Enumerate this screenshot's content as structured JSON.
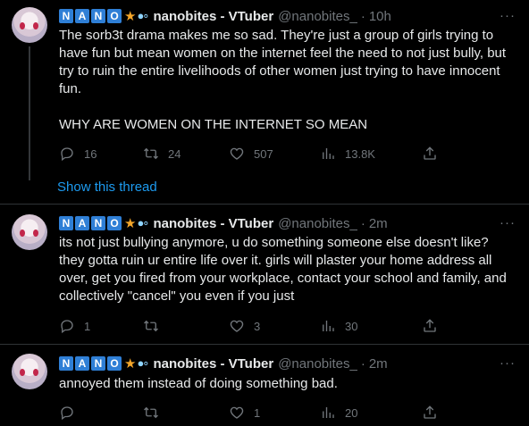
{
  "colors": {
    "background": "#000000",
    "text": "#e7e9ea",
    "muted": "#71767b",
    "link": "#1d9bf0",
    "badge": "#2f7fd6",
    "divider": "#2f3336"
  },
  "icons": [
    "avatar",
    "star-icon",
    "bubbles-icon",
    "more-icon",
    "reply-icon",
    "retweet-icon",
    "like-icon",
    "views-icon",
    "share-icon"
  ],
  "tweets": [
    {
      "badge_letters": [
        "N",
        "A",
        "N",
        "O"
      ],
      "display_name": "nanobites - VTuber",
      "handle": "@nanobites_",
      "dot": "·",
      "time": "10h",
      "more": "···",
      "text": "The sorb3t drama makes me so sad. They're just a group of girls trying to have fun but mean women on the internet feel the need to not just bully, but try to ruin the entire livelihoods of other women just trying to have innocent fun.\n\nWHY ARE WOMEN ON THE INTERNET SO MEAN",
      "stats": {
        "replies": "16",
        "retweets": "24",
        "likes": "507",
        "views": "13.8K"
      }
    },
    {
      "badge_letters": [
        "N",
        "A",
        "N",
        "O"
      ],
      "display_name": "nanobites - VTuber",
      "handle": "@nanobites_",
      "dot": "·",
      "time": "2m",
      "more": "···",
      "text": "its not just bullying anymore, u do something someone else doesn't like? they gotta ruin ur entire life over it. girls will plaster your home address all over, get you fired from your workplace, contact your school and family, and collectively \"cancel\" you even if you just",
      "stats": {
        "replies": "1",
        "retweets": "",
        "likes": "3",
        "views": "30"
      }
    },
    {
      "badge_letters": [
        "N",
        "A",
        "N",
        "O"
      ],
      "display_name": "nanobites - VTuber",
      "handle": "@nanobites_",
      "dot": "·",
      "time": "2m",
      "more": "···",
      "text": "annoyed them instead of doing something bad.",
      "stats": {
        "replies": "",
        "retweets": "",
        "likes": "1",
        "views": "20"
      }
    }
  ],
  "show_thread": "Show this thread"
}
